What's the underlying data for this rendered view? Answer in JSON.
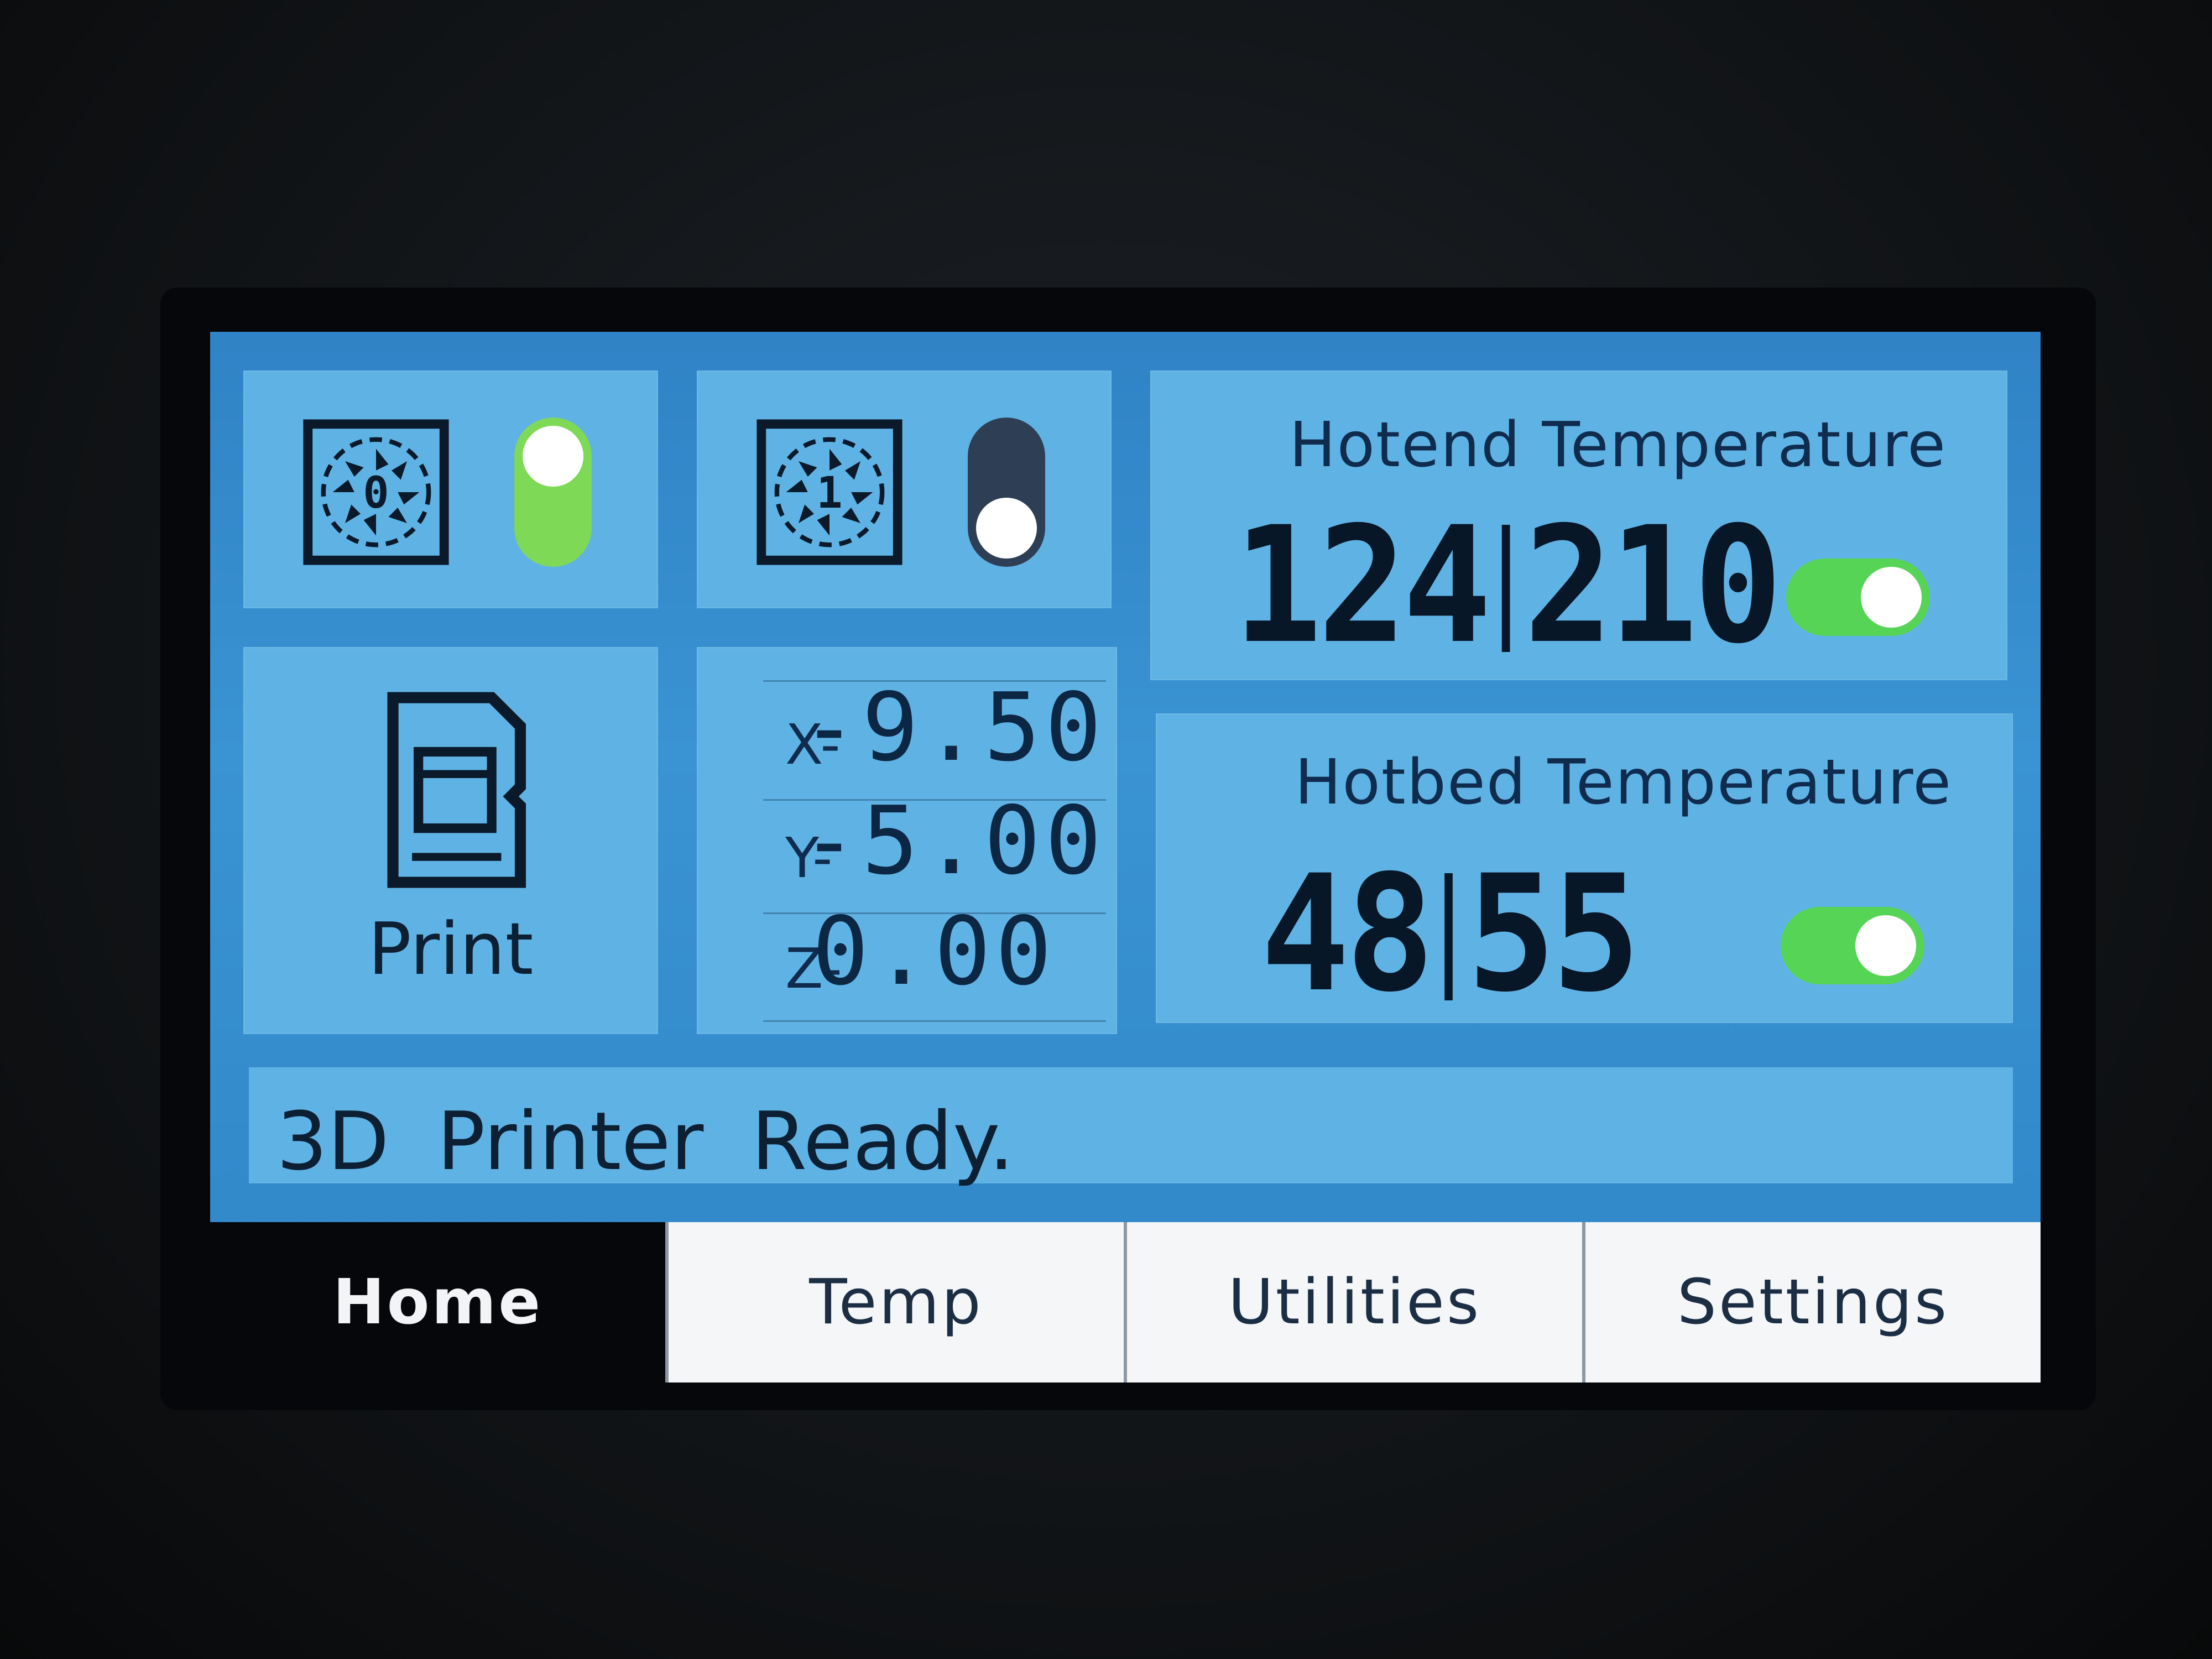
{
  "fans": [
    {
      "label": "0",
      "icon": "fan-icon",
      "enabled": true,
      "toggle_color": "#7ed957"
    },
    {
      "label": "1",
      "icon": "fan-icon",
      "enabled": false,
      "toggle_color": "#2e3f55"
    }
  ],
  "print": {
    "icon": "sd-card-icon",
    "label": "Print"
  },
  "position": {
    "x": {
      "label": "X-",
      "value": "-9.50"
    },
    "y": {
      "label": "Y-",
      "value": "-5.00"
    },
    "z": {
      "label": "Z-",
      "value": "0.00"
    }
  },
  "hotend": {
    "title": "Hotend Temperature",
    "current": "124",
    "target": "210",
    "enabled": true
  },
  "hotbed": {
    "title": "Hotbed Temperature",
    "current": "48",
    "target": "55",
    "enabled": true
  },
  "status": "3D Printer Ready.",
  "tabs": [
    {
      "label": "Home",
      "active": true
    },
    {
      "label": "Temp",
      "active": false
    },
    {
      "label": "Utilities",
      "active": false
    },
    {
      "label": "Settings",
      "active": false
    }
  ],
  "colors": {
    "screen_bg": "#2f86c8",
    "tile_bg": "#5fb3e4",
    "toggle_on": "#56d455",
    "text_dark": "#071728"
  }
}
